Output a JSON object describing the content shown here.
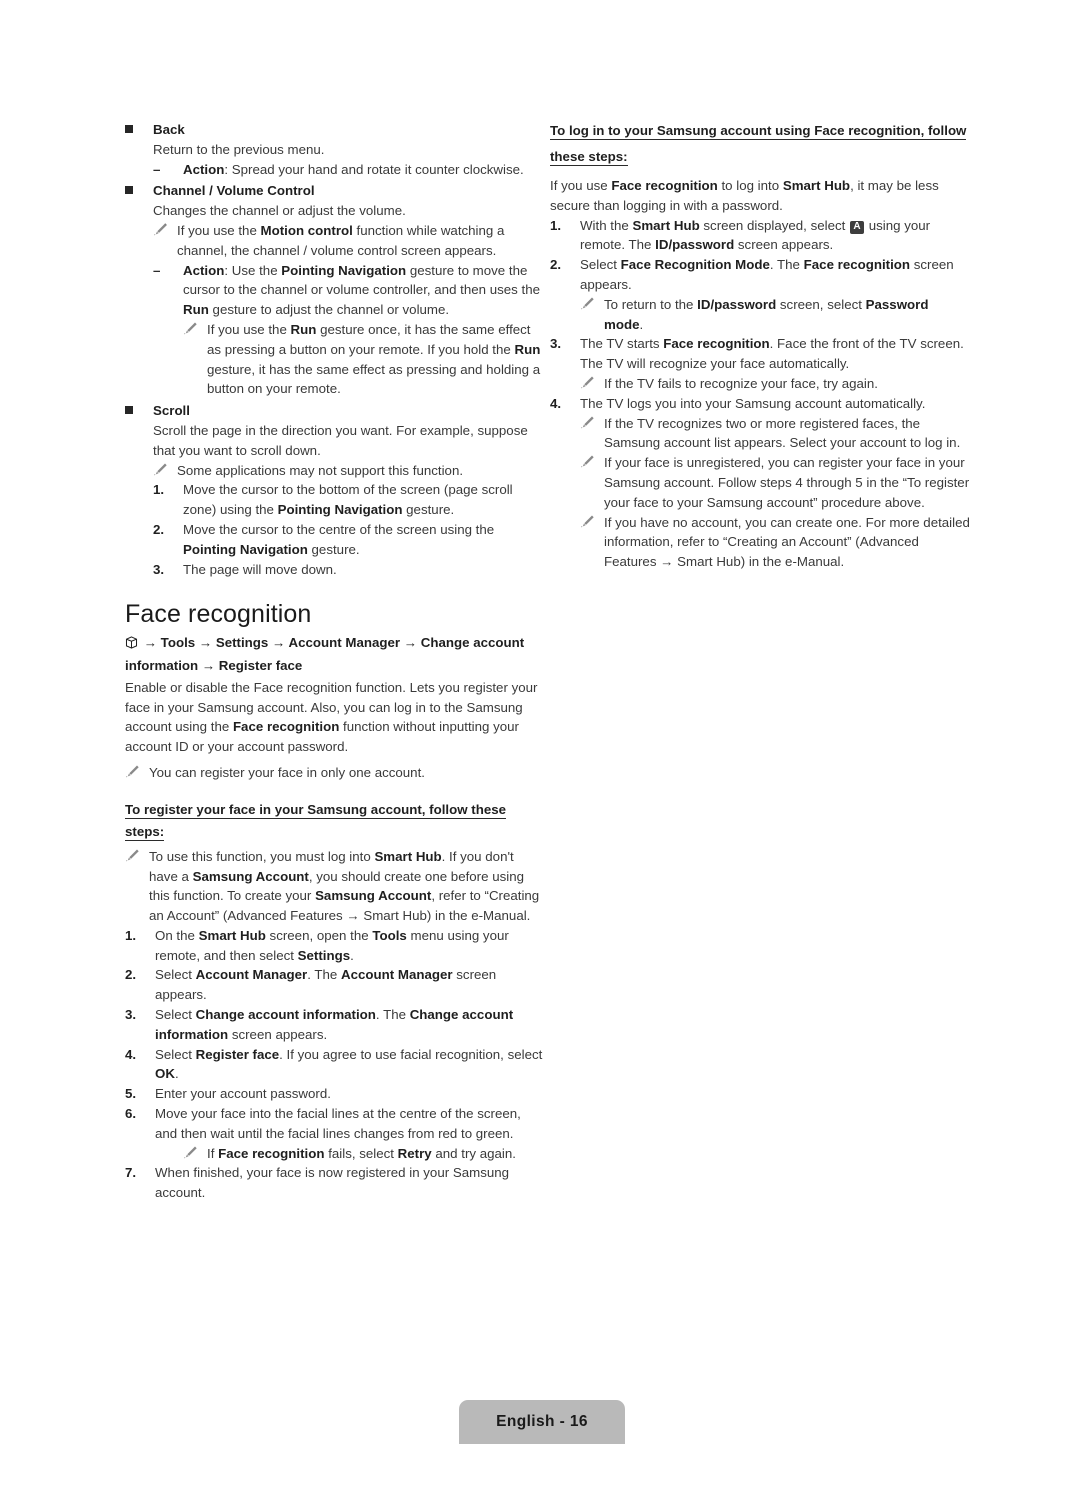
{
  "document": {
    "language_page_label": "English - 16"
  },
  "icons": {
    "square_bullet": "square-bullet-icon",
    "note": "note-pencil-icon",
    "smart_hub": "smart-hub-cube-icon",
    "key_a": "A"
  },
  "left_column": {
    "back_item": {
      "label": "Back",
      "description": "Return to the previous menu.",
      "action_label": "Action",
      "action_text": ": Spread your hand and rotate it counter clockwise."
    },
    "channel_volume_item": {
      "label": "Channel / Volume Control",
      "description": "Changes the channel or adjust the volume.",
      "note1_parts": [
        "If you use the ",
        "Motion control",
        " function while watching a channel, the channel / volume control screen appears."
      ],
      "action_label": "Action",
      "action_parts": [
        ": Use the ",
        "Pointing Navigation",
        " gesture to move the cursor to the channel or volume controller, and then uses the ",
        "Run",
        " gesture to adjust the channel or volume."
      ],
      "note2_parts": [
        "If you use the ",
        "Run",
        " gesture once, it has the same effect as pressing a button on your remote. If you hold the ",
        "Run",
        " gesture, it has the same effect as pressing and holding a button on your remote."
      ]
    },
    "scroll_item": {
      "label": "Scroll",
      "description": "Scroll the page in the direction you want. For example, suppose that you want to scroll down.",
      "note": "Some applications may not support this function.",
      "steps": [
        {
          "number": "1.",
          "parts": [
            "Move the cursor to the bottom of the screen (page scroll zone) using the ",
            "Pointing Navigation",
            " gesture."
          ]
        },
        {
          "number": "2.",
          "parts": [
            "Move the cursor to the centre of the screen using the ",
            "Pointing Navigation",
            " gesture."
          ]
        },
        {
          "number": "3.",
          "parts": [
            "The page will move down."
          ]
        }
      ]
    },
    "face_recognition": {
      "title": "Face recognition",
      "menu_path": " → Tools → Settings → Account Manager → Change account information → Register face",
      "intro_parts": [
        "Enable or disable the Face recognition function. Lets you register your face in your Samsung account. Also, you can log in to the Samsung account using the ",
        "Face recognition",
        " function without inputting your account ID or your account password."
      ],
      "intro_note": "You can register your face in only one account.",
      "register_heading": "To register your face in your Samsung account, follow these steps:",
      "register_note_parts": [
        "To use this function, you must log into ",
        "Smart Hub",
        ". If you don't have a ",
        "Samsung Account",
        ", you should create one before using this function. To create your ",
        "Samsung Account",
        ", refer to “Creating an Account” (Advanced Features → Smart Hub) in the e-Manual."
      ],
      "register_steps": [
        {
          "number": "1.",
          "parts": [
            "On the ",
            "Smart Hub",
            " screen, open the ",
            "Tools",
            " menu using your remote, and then select ",
            "Settings",
            "."
          ]
        },
        {
          "number": "2.",
          "parts": [
            "Select ",
            "Account Manager",
            ". The ",
            "Account Manager",
            " screen appears."
          ]
        },
        {
          "number": "3.",
          "parts": [
            "Select ",
            "Change account information",
            ". The ",
            "Change account information",
            " screen appears."
          ]
        },
        {
          "number": "4.",
          "parts": [
            "Select ",
            "Register face",
            ". If you agree to use facial recognition, select ",
            "OK",
            "."
          ]
        },
        {
          "number": "5.",
          "parts": [
            "Enter your account password."
          ]
        },
        {
          "number": "6.",
          "parts": [
            "Move your face into the facial lines at the centre of the screen, and then wait until the facial lines changes from red to green."
          ],
          "note_parts": [
            "If ",
            "Face recognition",
            " fails, select ",
            "Retry",
            " and try again."
          ]
        },
        {
          "number": "7.",
          "parts": [
            "When finished, your face is now registered in your Samsung account."
          ]
        }
      ]
    }
  },
  "right_column": {
    "login_heading_line1": "To log in to your Samsung account using Face recognition, follow",
    "login_heading_line2": "these steps:",
    "intro_parts": [
      "If you use ",
      "Face recognition",
      " to log into ",
      "Smart Hub",
      ", it may be less secure than logging in with a password."
    ],
    "steps": [
      {
        "number": "1.",
        "parts_before_key": [
          "With the ",
          "Smart Hub",
          " screen displayed, select "
        ],
        "key": "A",
        "parts_after_key": [
          " using your remote. The ",
          "ID/password",
          " screen appears."
        ]
      },
      {
        "number": "2.",
        "parts": [
          "Select ",
          "Face Recognition Mode",
          ". The ",
          "Face recognition",
          " screen appears."
        ],
        "note_parts": [
          "To return to the ",
          "ID/password",
          " screen, select ",
          "Password mode",
          "."
        ]
      },
      {
        "number": "3.",
        "parts": [
          "The TV starts ",
          "Face recognition",
          ". Face the front of the TV screen. The TV will recognize your face automatically."
        ],
        "note_parts": [
          "If the TV fails to recognize your face, try again."
        ]
      },
      {
        "number": "4.",
        "parts": [
          "The TV logs you into your Samsung account automatically."
        ],
        "notes": [
          {
            "parts": [
              "If the TV recognizes two or more registered faces, the Samsung account list appears. Select your account to log in."
            ]
          },
          {
            "parts": [
              "If your face is unregistered, you can register your face in your Samsung account. Follow steps 4 through 5 in the “To register your face to your Samsung account” procedure above."
            ]
          },
          {
            "parts": [
              "If you have no account, you can create one. For more detailed information, refer to “Creating an Account” (Advanced Features → Smart Hub) in the e-Manual."
            ]
          }
        ]
      }
    ]
  }
}
